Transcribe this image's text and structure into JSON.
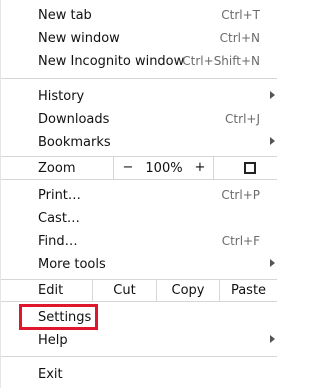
{
  "menu": {
    "new_tab": {
      "label": "New tab",
      "shortcut": "Ctrl+T"
    },
    "new_window": {
      "label": "New window",
      "shortcut": "Ctrl+N"
    },
    "new_incognito": {
      "label": "New Incognito window",
      "shortcut": "Ctrl+Shift+N"
    },
    "history": {
      "label": "History"
    },
    "downloads": {
      "label": "Downloads",
      "shortcut": "Ctrl+J"
    },
    "bookmarks": {
      "label": "Bookmarks"
    },
    "zoom": {
      "label": "Zoom",
      "minus": "−",
      "value": "100%",
      "plus": "+"
    },
    "print": {
      "label": "Print…",
      "shortcut": "Ctrl+P"
    },
    "cast": {
      "label": "Cast…"
    },
    "find": {
      "label": "Find…",
      "shortcut": "Ctrl+F"
    },
    "more_tools": {
      "label": "More tools"
    },
    "edit": {
      "label": "Edit",
      "cut": "Cut",
      "copy": "Copy",
      "paste": "Paste"
    },
    "settings": {
      "label": "Settings"
    },
    "help": {
      "label": "Help"
    },
    "exit": {
      "label": "Exit"
    }
  },
  "highlight_color": "#e0172c"
}
